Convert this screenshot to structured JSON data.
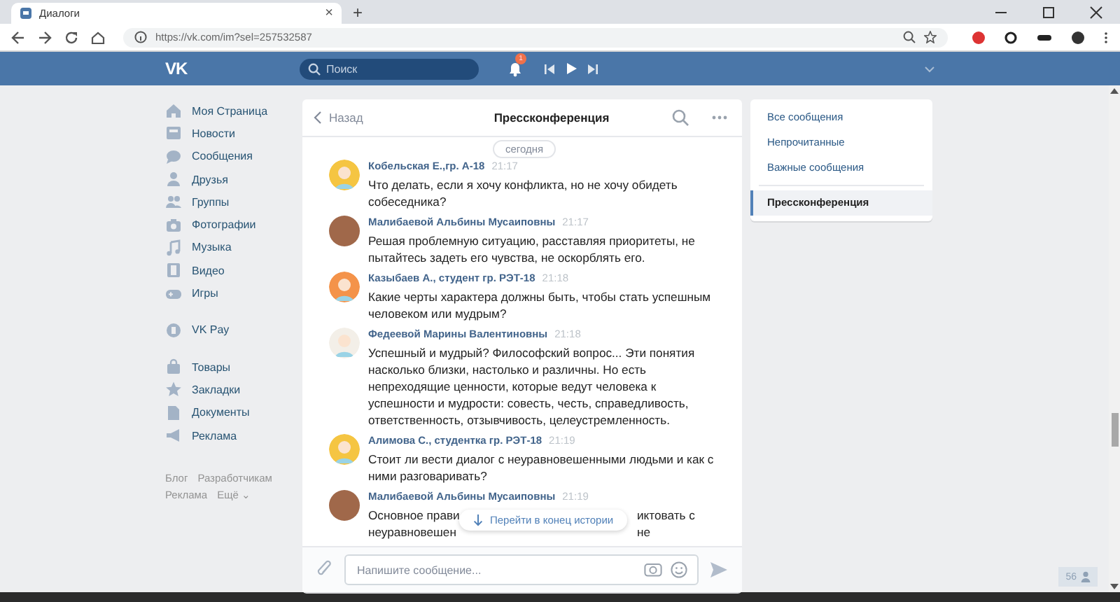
{
  "browser": {
    "tab": {
      "title": "Диалоги",
      "close": "×"
    },
    "new_tab": "+",
    "url": "https://vk.com/im?sel=257532587"
  },
  "header": {
    "logo": "VK",
    "search": {
      "placeholder": "Поиск"
    },
    "notifications_badge": "1"
  },
  "sidebar": {
    "sections": [
      [
        {
          "label": "Моя Страница"
        },
        {
          "label": "Новости"
        },
        {
          "label": "Сообщения"
        },
        {
          "label": "Друзья"
        },
        {
          "label": "Группы"
        },
        {
          "label": "Фотографии"
        },
        {
          "label": "Музыка"
        },
        {
          "label": "Видео"
        },
        {
          "label": "Игры"
        }
      ],
      [
        {
          "label": "VK Pay"
        }
      ],
      [
        {
          "label": "Товары"
        },
        {
          "label": "Закладки"
        },
        {
          "label": "Документы"
        },
        {
          "label": "Реклама"
        }
      ]
    ],
    "footer_links": [
      "Блог",
      "Разработчикам",
      "Реклама",
      "Ещё ⌄"
    ]
  },
  "chat": {
    "back": "Назад",
    "title": "Пресcконференция",
    "date_divider": "сегодня",
    "messages": [
      {
        "author": "Кобельская Е.,гр. А-18",
        "time": "21:17",
        "avatar": {
          "kind": "cartoon",
          "color": "#f5c542"
        },
        "text": "Что делать, если я хочу конфликта, но не хочу обидеть собеседника?"
      },
      {
        "author": "Малибаевой Альбины Мусаиповны",
        "time": "21:17",
        "avatar": {
          "kind": "photo",
          "color": "#a0684a"
        },
        "text": "Решая проблемную ситуацию, расставляя приоритеты, не пытайтесь задеть его чувства, не оскорблять его."
      },
      {
        "author": "Казыбаев А., студент гр. РЭТ-18",
        "time": "21:18",
        "avatar": {
          "kind": "cartoon",
          "color": "#f4934a"
        },
        "text": "Какие черты характера должны быть, чтобы стать успешным человеком или мудрым?"
      },
      {
        "author": "Федеевой Марины Валентиновны",
        "time": "21:18",
        "avatar": {
          "kind": "cartoon",
          "color": "#f3efe8"
        },
        "text": "Успешный и мудрый? Философский вопрос... Эти понятия насколько близки, настолько и различны. Но есть непреходящие ценности, которые ведут человека к успешности и мудрости: совесть, честь, справедливость, ответственность, отзывчивость, целеустремленность."
      },
      {
        "author": "Алимова С., студентка гр. РЭТ-18",
        "time": "21:19",
        "avatar": {
          "kind": "cartoon",
          "color": "#f5c542"
        },
        "text": "Стоит ли вести диалог с неуравновешенными людьми и как с ними разговаривать?"
      },
      {
        "author": "Малибаевой Альбины Мусаиповны",
        "time": "21:19",
        "avatar": {
          "kind": "photo",
          "color": "#a0684a"
        },
        "partial_lines": [
          {
            "left": "Основное прави",
            "right": "иктовать с"
          },
          {
            "left": "неуравновешен",
            "right": "не"
          }
        ]
      }
    ],
    "jump_button": "Перейти в конец истории",
    "compose": {
      "placeholder": "Напишите сообщение..."
    }
  },
  "right_menu": {
    "groups": [
      [
        {
          "label": "Все сообщения",
          "selected": false
        },
        {
          "label": "Непрочитанные",
          "selected": false
        },
        {
          "label": "Важные сообщения",
          "selected": false
        }
      ],
      [
        {
          "label": "Пресcконференция",
          "selected": true
        }
      ]
    ]
  },
  "online_widget": {
    "count": "56"
  }
}
